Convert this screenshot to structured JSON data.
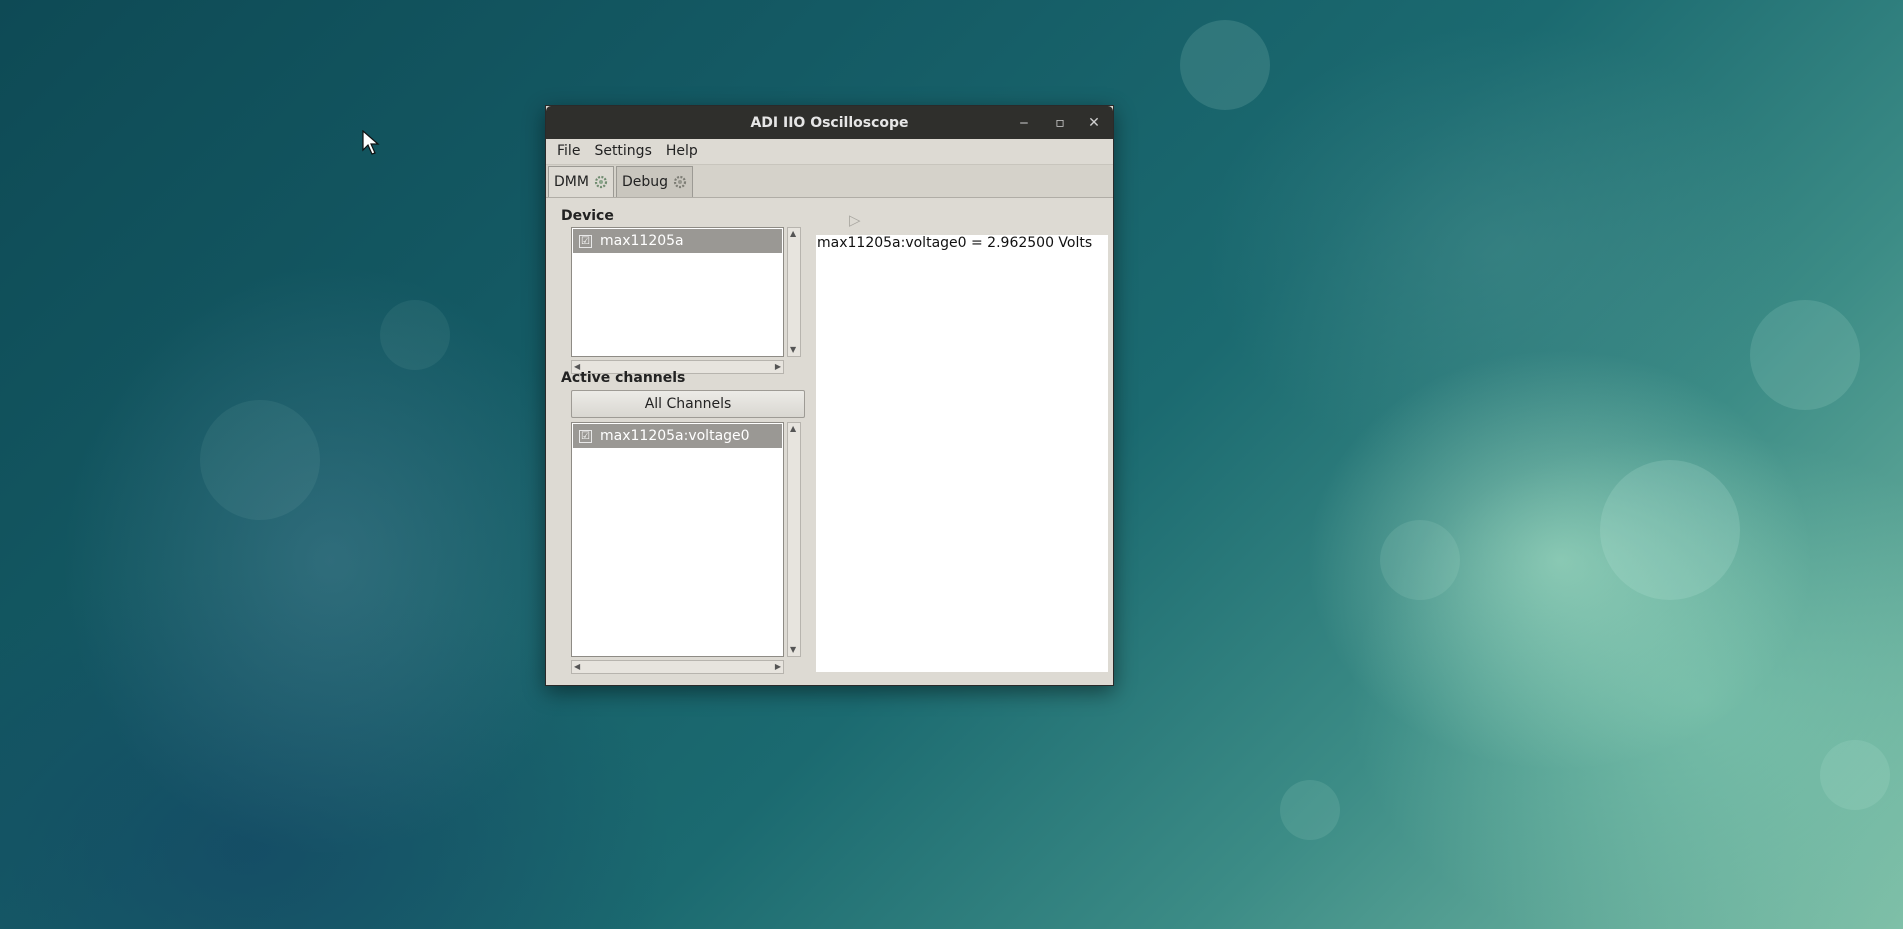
{
  "window": {
    "title": "ADI IIO Oscilloscope",
    "minimize_glyph": "‒",
    "maximize_glyph": "▫",
    "close_glyph": "✕"
  },
  "menubar": {
    "items": [
      {
        "label": "File"
      },
      {
        "label": "Settings"
      },
      {
        "label": "Help"
      }
    ]
  },
  "tabs": [
    {
      "label": "DMM",
      "icon": "settings-gear-icon",
      "active": true
    },
    {
      "label": "Debug",
      "icon": "settings-gear-icon",
      "active": false
    }
  ],
  "device_panel": {
    "label": "Device",
    "items": [
      {
        "label": "max11205a",
        "checked": true,
        "check_glyph": "☑"
      }
    ]
  },
  "channels_panel": {
    "label": "Active channels",
    "all_button_label": "All Channels",
    "items": [
      {
        "label": "max11205a:voltage0",
        "checked": true,
        "check_glyph": "☑"
      }
    ]
  },
  "output": {
    "play_glyph": "▷",
    "lines": [
      "max11205a:voltage0 = 2.962500 Volts"
    ]
  },
  "colors": {
    "titlebar_bg": "#2f2f2c",
    "window_bg": "#dddad3",
    "selected_row": "#9a9894"
  }
}
